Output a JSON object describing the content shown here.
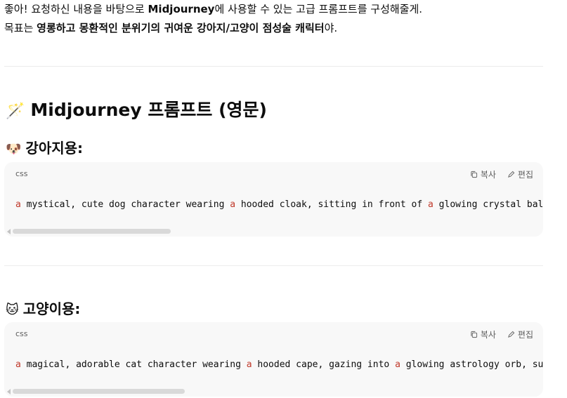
{
  "intro": {
    "line1_a": "좋아! 요청하신 내용을 바탕으로 ",
    "line1_b": "Midjourney",
    "line1_c": "에 사용할 수 있는 고급 프롬프트를 구성해줄게.",
    "line2_a": "목표는 ",
    "line2_b": "영롱하고 몽환적인 분위기의 귀여운 강아지/고양이 점성술 캐릭터",
    "line2_c": "야."
  },
  "heading": {
    "emoji": "🪄",
    "title": "Midjourney 프롬프트 (영문)"
  },
  "sections": [
    {
      "emoji": "🐶",
      "title": "강아지용:",
      "lang": "css",
      "copy_label": "복사",
      "edit_label": "편집",
      "code_parts": [
        "a",
        " mystical, cute dog character wearing ",
        "a",
        " hooded cloak, sitting in front of ",
        "a",
        " glowing crystal ball,"
      ]
    },
    {
      "emoji": "🐱",
      "title": "고양이용:",
      "lang": "css",
      "copy_label": "복사",
      "edit_label": "편집",
      "code_parts": [
        "a",
        " magical, adorable cat character wearing ",
        "a",
        " hooded cape, gazing into ",
        "a",
        " glowing astrology orb, surr"
      ]
    }
  ]
}
